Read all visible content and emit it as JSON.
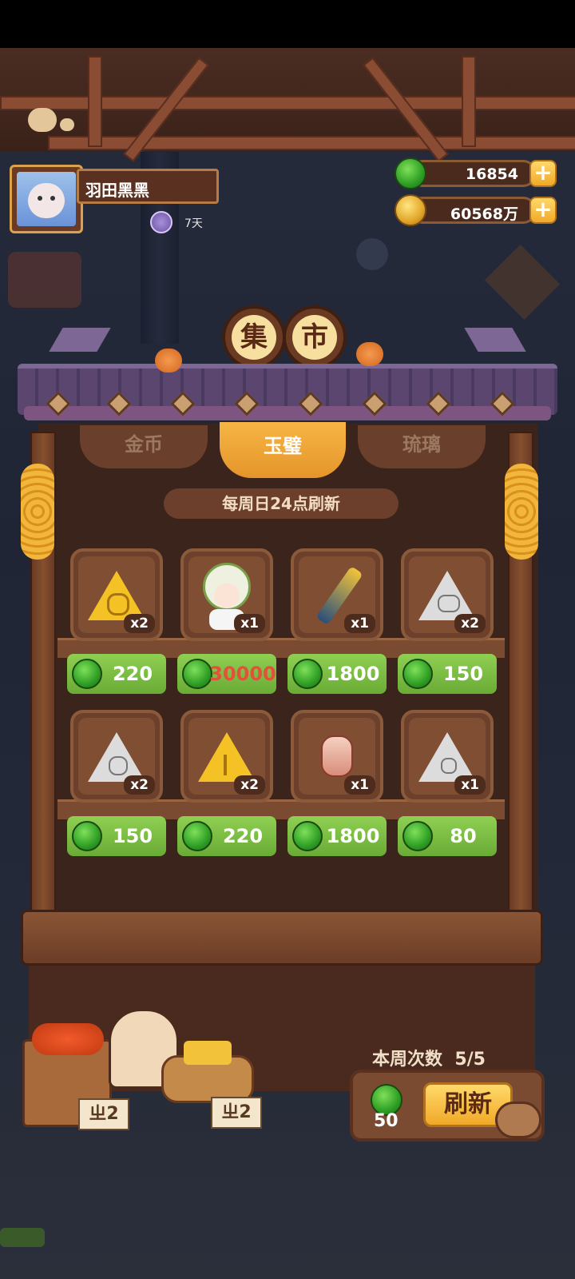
{
  "player": {
    "name": "羽田黑黑",
    "vip_days": "7天"
  },
  "currency": {
    "jade": "16854",
    "coins": "60568万"
  },
  "market": {
    "title_chars": [
      "集",
      "市"
    ],
    "tabs": [
      {
        "label": "金币",
        "selected": false
      },
      {
        "label": "玉璧",
        "selected": true
      },
      {
        "label": "琉璃",
        "selected": false
      }
    ],
    "refresh_note": "每周日24点刷新",
    "items": [
      {
        "icon": "golden-triangle-spiral-icon",
        "qty": "x2",
        "price": "220"
      },
      {
        "icon": "green-haired-character-icon",
        "qty": "x1",
        "price": "30000"
      },
      {
        "icon": "ornate-handle-icon",
        "qty": "x1",
        "price": "1800"
      },
      {
        "icon": "silver-triangle-crab-icon",
        "qty": "x2",
        "price": "150"
      },
      {
        "icon": "silver-triangle-swirl-icon",
        "qty": "x2",
        "price": "150"
      },
      {
        "icon": "golden-triangle-coral-icon",
        "qty": "x2",
        "price": "220"
      },
      {
        "icon": "paper-lantern-icon",
        "qty": "x1",
        "price": "1800"
      },
      {
        "icon": "silver-triangle-sun-icon",
        "qty": "x1",
        "price": "80"
      }
    ],
    "price_colors": {
      "affordable": "#ffffff",
      "unaffordable": "#e0523a"
    }
  },
  "refresh": {
    "weekly_label": "本周次数",
    "weekly_count": "5/5",
    "cost": "50",
    "button_label": "刷新"
  },
  "decor": {
    "sign_left": "ㄓ2",
    "sign_right": "ㄓ2"
  }
}
